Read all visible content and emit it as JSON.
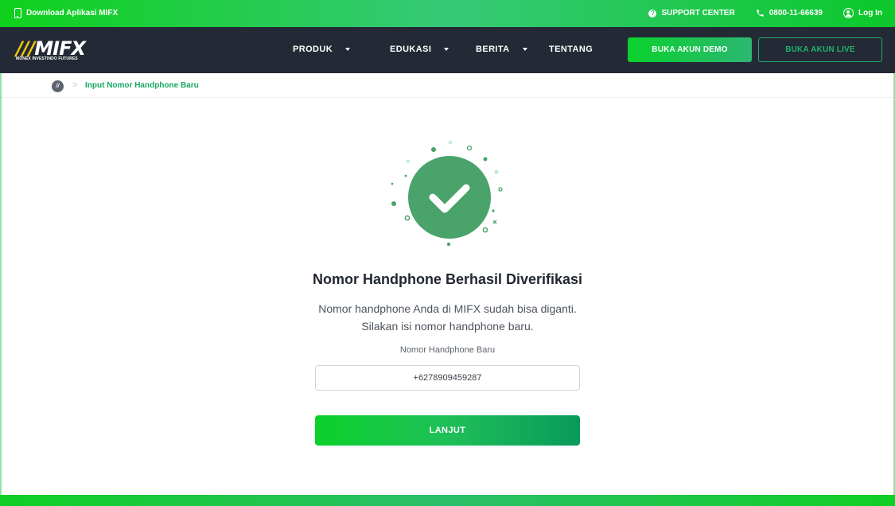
{
  "topbar": {
    "download_label": "Download Aplikasi MIFX",
    "support_label": "SUPPORT CENTER",
    "phone_label": "0800-11-66639",
    "login_label": "Log In"
  },
  "header": {
    "logo_text": "MIFX",
    "logo_subtext": "MONEX INVESTINDO FUTURES",
    "menu": [
      {
        "label": "PRODUK"
      },
      {
        "label": "EDUKASI"
      },
      {
        "label": "BERITA"
      },
      {
        "label": "TENTANG"
      }
    ],
    "demo_label": "BUKA AKUN DEMO",
    "live_label": "BUKA AKUN LIVE"
  },
  "breadcrumb": {
    "current": "Input Nomor Handphone Baru"
  },
  "main": {
    "title": "Nomor Handphone Berhasil Diverifikasi",
    "desc_line1": "Nomor handphone Anda di MIFX sudah bisa diganti.",
    "desc_line2": "Silakan isi nomor handphone baru.",
    "field_label": "Nomor Handphone Baru",
    "phone_value": "+6278909459287",
    "next_label": "LANJUT"
  },
  "colors": {
    "brand_green": "#1fc959",
    "nav_bg": "#232a35",
    "success_circle": "#4aa36a"
  },
  "icons": [
    "mobile-phone-icon",
    "question-icon",
    "phone-icon",
    "user-icon",
    "caret-down-icon",
    "home-icon",
    "checkmark-icon"
  ]
}
